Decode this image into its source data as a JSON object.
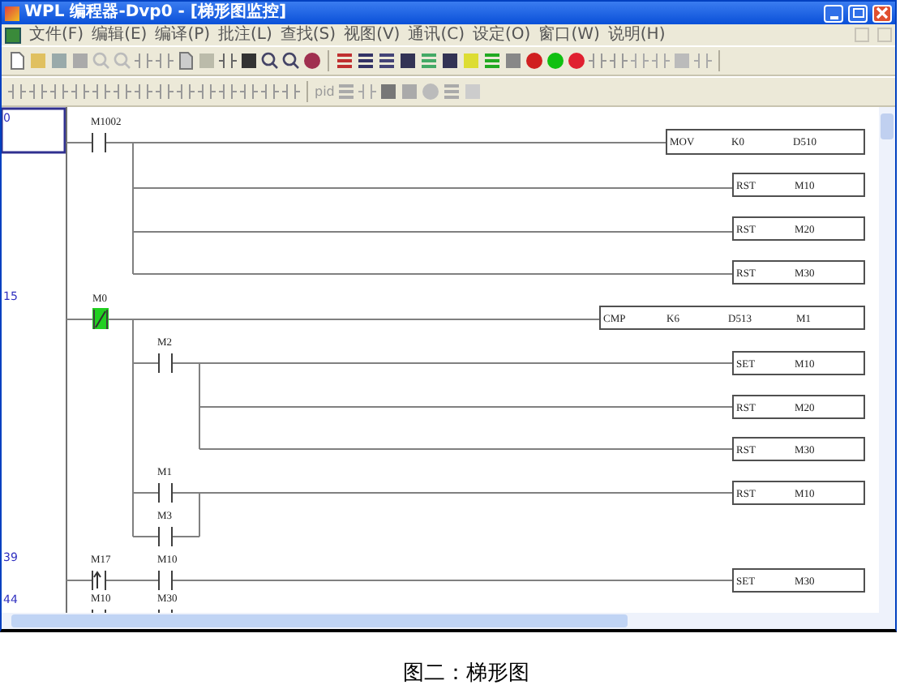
{
  "window": {
    "title": "WPL 编程器-Dvp0 - [梯形图监控]"
  },
  "menu": [
    "文件(F)",
    "编辑(E)",
    "编译(P)",
    "批注(L)",
    "查找(S)",
    "视图(V)",
    "通讯(C)",
    "设定(O)",
    "窗口(W)",
    "说明(H)"
  ],
  "toolbar_2": {
    "label": "pid"
  },
  "ladder": {
    "rungs": [
      {
        "step": "0",
        "contacts": [
          {
            "label": "M1002",
            "kind": "no",
            "on": false
          }
        ],
        "outputs": [
          {
            "kind": "box",
            "cells": [
              "MOV",
              "K0",
              "D510"
            ]
          },
          {
            "kind": "box",
            "cells": [
              "RST",
              "M10"
            ]
          },
          {
            "kind": "box",
            "cells": [
              "RST",
              "M20"
            ]
          },
          {
            "kind": "box",
            "cells": [
              "RST",
              "M30"
            ]
          }
        ]
      },
      {
        "step": "15",
        "contacts": [
          {
            "label": "M0",
            "kind": "nc",
            "on": true
          },
          {
            "label": "M2",
            "kind": "no",
            "on": false
          },
          {
            "label": "M1",
            "kind": "no",
            "on": false
          },
          {
            "label": "M3",
            "kind": "no",
            "on": false
          }
        ],
        "outputs": [
          {
            "kind": "box",
            "cells": [
              "CMP",
              "K6",
              "D513",
              "M1"
            ]
          },
          {
            "kind": "box",
            "cells": [
              "SET",
              "M10"
            ]
          },
          {
            "kind": "box",
            "cells": [
              "RST",
              "M20"
            ]
          },
          {
            "kind": "box",
            "cells": [
              "RST",
              "M30"
            ]
          },
          {
            "kind": "box",
            "cells": [
              "RST",
              "M10"
            ]
          }
        ]
      },
      {
        "step": "39",
        "contacts": [
          {
            "label": "M17",
            "kind": "rise",
            "on": false
          },
          {
            "label": "M10",
            "kind": "no",
            "on": false
          }
        ],
        "outputs": [
          {
            "kind": "box",
            "cells": [
              "SET",
              "M30"
            ]
          }
        ]
      },
      {
        "step": "44",
        "contacts": [
          {
            "label": "M10",
            "kind": "no",
            "on": false
          },
          {
            "label": "M30",
            "kind": "no",
            "on": false
          }
        ],
        "outputs": [
          {
            "kind": "partial"
          }
        ]
      }
    ]
  },
  "caption": "图二：梯形图"
}
